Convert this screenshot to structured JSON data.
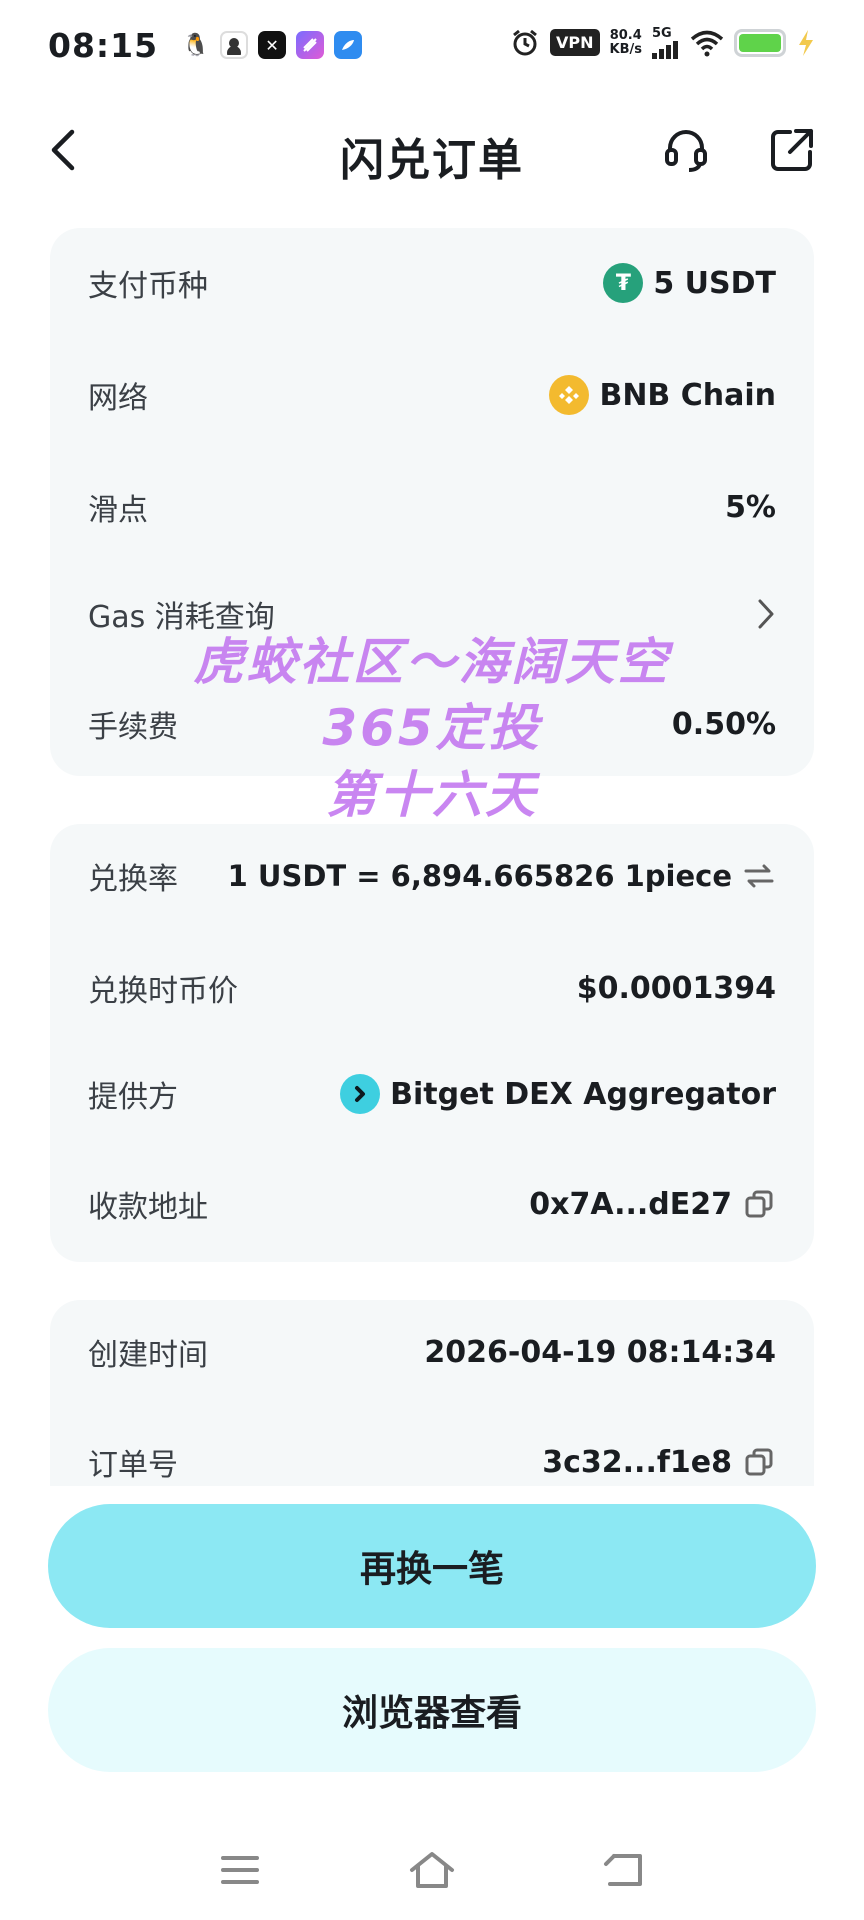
{
  "status_bar": {
    "time": "08:15",
    "vpn": "VPN",
    "speed_value": "80.4",
    "speed_unit": "KB/s",
    "network": "5G",
    "battery_color": "#5fd34a"
  },
  "header": {
    "title": "闪兑订单"
  },
  "card1": {
    "pay_label": "支付币种",
    "pay_value": "5 USDT",
    "network_label": "网络",
    "network_value": "BNB Chain",
    "slippage_label": "滑点",
    "slippage_value": "5%",
    "gas_label": "Gas 消耗查询",
    "fee_label": "手续费",
    "fee_value": "0.50%"
  },
  "card2": {
    "rate_label": "兑换率",
    "rate_value": "1 USDT = 6,894.665826 1piece",
    "price_label": "兑换时币价",
    "price_value": "$0.0001394",
    "provider_label": "提供方",
    "provider_value": "Bitget DEX Aggregator",
    "address_label": "收款地址",
    "address_value": "0x7A...dE27"
  },
  "card3": {
    "created_label": "创建时间",
    "created_value": "2026-04-19 08:14:34",
    "order_label": "订单号",
    "order_value": "3c32...f1e8"
  },
  "watermark": {
    "line1": "虎蛟社区～海阔天空",
    "line2": "365定投",
    "line3": "第十六天"
  },
  "buttons": {
    "swap_again": "再换一笔",
    "view_browser": "浏览器查看"
  },
  "colors": {
    "accent": "#8ce8f3",
    "secondary": "#e6fbfd",
    "usdt": "#26a17b",
    "bnb": "#f3ba2f",
    "provider": "#3ecfe0",
    "watermark": "#c57cf0"
  }
}
